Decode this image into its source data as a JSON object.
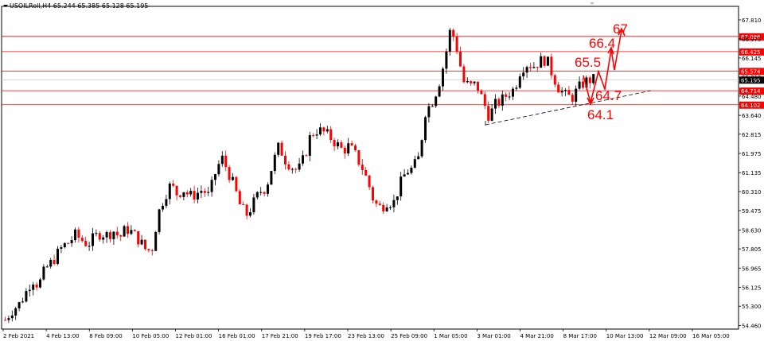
{
  "header": {
    "symbol": "USOILRoll",
    "timeframe": "H4",
    "ohlc": "65.244 65.385 65.128 65.195"
  },
  "colors": {
    "bull": "#000000",
    "bear": "#ff0000",
    "level_line": "#ff0000",
    "current_price_bg": "#000000",
    "trendline": "#000000",
    "annotation": "#ff0000"
  },
  "chart_data": {
    "type": "candlestick",
    "title": "USOILRoll,H4",
    "ylim": [
      54.3,
      68.4
    ],
    "y_ticks": [
      "67.810",
      "66.975",
      "66.145",
      "65.310",
      "64.480",
      "63.640",
      "62.815",
      "61.975",
      "61.135",
      "60.310",
      "59.475",
      "58.630",
      "57.805",
      "56.965",
      "56.125",
      "55.300",
      "54.460"
    ],
    "x_ticks": [
      "2 Feb 2021",
      "4 Feb 13:00",
      "8 Feb 09:00",
      "10 Feb 05:00",
      "12 Feb 01:00",
      "16 Feb 01:00",
      "17 Feb 21:00",
      "19 Feb 17:00",
      "23 Feb 13:00",
      "25 Feb 09:00",
      "1 Mar 05:00",
      "3 Mar 01:00",
      "4 Mar 21:00",
      "8 Mar 17:00",
      "10 Mar 13:00",
      "12 Mar 09:00",
      "16 Mar 05:00"
    ],
    "price_levels": [
      "67.086",
      "66.425",
      "65.574",
      "64.714",
      "64.102"
    ],
    "current_price": "65.195",
    "grid": false,
    "annotations": [
      "67",
      "66.4",
      "65.5",
      "64.7",
      "64.1"
    ],
    "close_path": [
      [
        0,
        54.7
      ],
      [
        8,
        55.1
      ],
      [
        18,
        55.4
      ],
      [
        26,
        55.9
      ],
      [
        34,
        56.5
      ],
      [
        42,
        56.2
      ],
      [
        50,
        56.9
      ],
      [
        58,
        57.2
      ],
      [
        66,
        57.6
      ],
      [
        72,
        57.9
      ],
      [
        80,
        58.1
      ],
      [
        88,
        58.4
      ],
      [
        96,
        58.2
      ],
      [
        104,
        58.0
      ],
      [
        112,
        58.3
      ],
      [
        120,
        58.5
      ],
      [
        128,
        58.4
      ],
      [
        136,
        58.6
      ],
      [
        144,
        58.3
      ],
      [
        152,
        58.7
      ],
      [
        160,
        58.5
      ],
      [
        168,
        58.2
      ],
      [
        176,
        57.8
      ],
      [
        184,
        57.7
      ],
      [
        192,
        59.3
      ],
      [
        200,
        60.1
      ],
      [
        208,
        60.6
      ],
      [
        216,
        60.2
      ],
      [
        224,
        60.4
      ],
      [
        232,
        60.1
      ],
      [
        240,
        60.2
      ],
      [
        248,
        60.4
      ],
      [
        256,
        60.1
      ],
      [
        264,
        61.1
      ],
      [
        272,
        61.8
      ],
      [
        280,
        61.2
      ],
      [
        288,
        60.5
      ],
      [
        296,
        59.6
      ],
      [
        304,
        59.3
      ],
      [
        312,
        59.8
      ],
      [
        320,
        60.3
      ],
      [
        328,
        60.5
      ],
      [
        336,
        61.5
      ],
      [
        344,
        62.3
      ],
      [
        352,
        61.7
      ],
      [
        360,
        61.4
      ],
      [
        368,
        61.2
      ],
      [
        376,
        61.8
      ],
      [
        384,
        62.8
      ],
      [
        392,
        63.0
      ],
      [
        400,
        62.9
      ],
      [
        408,
        62.7
      ],
      [
        416,
        62.4
      ],
      [
        424,
        62.1
      ],
      [
        432,
        62.3
      ],
      [
        440,
        61.9
      ],
      [
        448,
        61.4
      ],
      [
        456,
        60.7
      ],
      [
        464,
        59.8
      ],
      [
        472,
        59.6
      ],
      [
        480,
        59.9
      ],
      [
        488,
        59.8
      ],
      [
        496,
        60.6
      ],
      [
        504,
        61.2
      ],
      [
        512,
        61.3
      ],
      [
        520,
        61.8
      ],
      [
        528,
        63.8
      ],
      [
        536,
        64.2
      ],
      [
        544,
        64.9
      ],
      [
        552,
        66.0
      ],
      [
        560,
        67.5
      ],
      [
        568,
        66.5
      ],
      [
        576,
        65.1
      ],
      [
        584,
        64.9
      ],
      [
        592,
        65.0
      ],
      [
        600,
        64.3
      ],
      [
        608,
        63.6
      ],
      [
        616,
        64.1
      ],
      [
        624,
        64.3
      ],
      [
        632,
        64.6
      ],
      [
        640,
        64.8
      ],
      [
        648,
        65.7
      ],
      [
        656,
        65.9
      ],
      [
        664,
        65.8
      ],
      [
        672,
        66.0
      ],
      [
        680,
        66.1
      ],
      [
        688,
        65.4
      ],
      [
        696,
        64.8
      ],
      [
        704,
        64.5
      ],
      [
        712,
        64.4
      ],
      [
        720,
        64.8
      ],
      [
        728,
        65.1
      ],
      [
        736,
        65.2
      ],
      [
        740,
        65.195
      ]
    ]
  },
  "annotations": {
    "a67": "67",
    "a664": "66.4",
    "a655": "65.5",
    "a647": "64.7",
    "a641": "64.1"
  }
}
